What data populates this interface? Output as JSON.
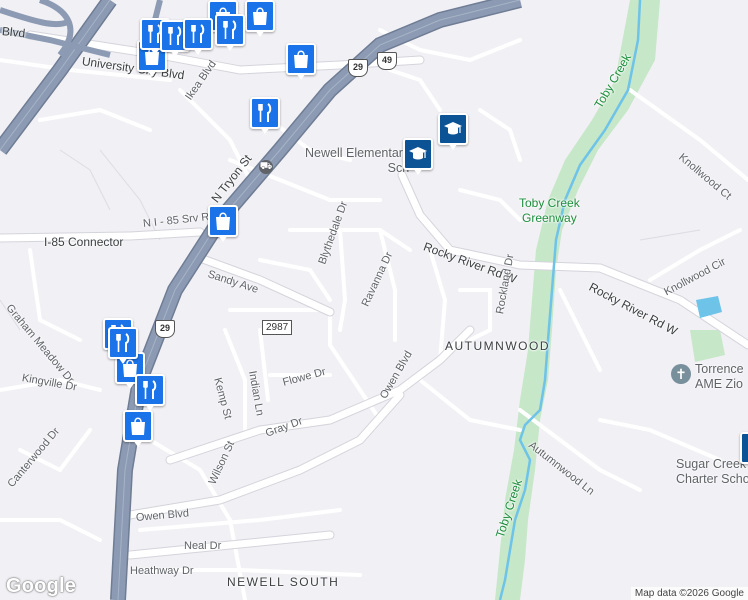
{
  "map": {
    "streets": {
      "university_city_blvd_left": "Blvd",
      "university_city_blvd": "University City Blvd",
      "ikea_blvd": "Ikea Blvd",
      "tryon_st": "N Tryon St",
      "n_i85_srv_rd": "N I - 85 Srv Rd",
      "i85_connector": "I-85 Connector",
      "sandy_ave": "Sandy Ave",
      "blythedale_dr": "Blythedale Dr",
      "ravanna_dr": "Ravanna Dr",
      "rocky_river_rd_w_1": "Rocky River Rd W",
      "rocky_river_rd_w_2": "Rocky River Rd W",
      "knollwood_ct": "Knollwood Ct",
      "knollwood_cir": "Knollwood Cir",
      "rockland_dr": "Rockland Dr",
      "graham_meadow_dr": "Graham Meadow Dr",
      "kemp_st": "Kemp St",
      "indian_ln": "Indian Ln",
      "kingville_dr": "Kingville Dr",
      "flowe_dr": "Flowe Dr",
      "owen_blvd_diag": "Owen Blvd",
      "gray_dr": "Gray Dr",
      "autumnwood_ln": "Autumnwood Ln",
      "canterwood_dr": "Canterwood Dr",
      "wilson_st": "Wilson St",
      "owen_blvd": "Owen Blvd",
      "neal_dr": "Neal Dr",
      "heathway_dr": "Heathway Dr"
    },
    "waterways": {
      "toby_creek_top": "Toby Creek",
      "toby_creek_bottom": "Toby Creek"
    },
    "parks": {
      "toby_creek_greenway": "Toby Creek\nGreenway"
    },
    "neighborhoods": {
      "autumnwood": "AUTUMNWOOD",
      "newell_south": "NEWELL SOUTH"
    },
    "pois": {
      "newell_elementary": "Newell Elementary\nSch",
      "torrence_ame": "Torrence\nAME Zio",
      "sugar_creek_charter": "Sugar Creek\nCharter School"
    },
    "route_shields": {
      "us29_top": "29",
      "us49": "49",
      "us29_bottom": "29",
      "sr2987": "2987"
    },
    "marker_icons": [
      "shopping-bag-icon",
      "restaurant-icon",
      "school-icon"
    ],
    "colors": {
      "background": "#f1f0f4",
      "highway": "#8c9bb3",
      "highway_edge": "#6e7c94",
      "road": "#ffffff",
      "road_edge": "#d4d4dc",
      "park": "#c6e7c8",
      "water": "#6ec3e8",
      "marker_blue": "#1a73e8",
      "marker_dark_blue": "#0b5394"
    },
    "logo": "Google",
    "attribution": "Map data ©2026 Google"
  }
}
